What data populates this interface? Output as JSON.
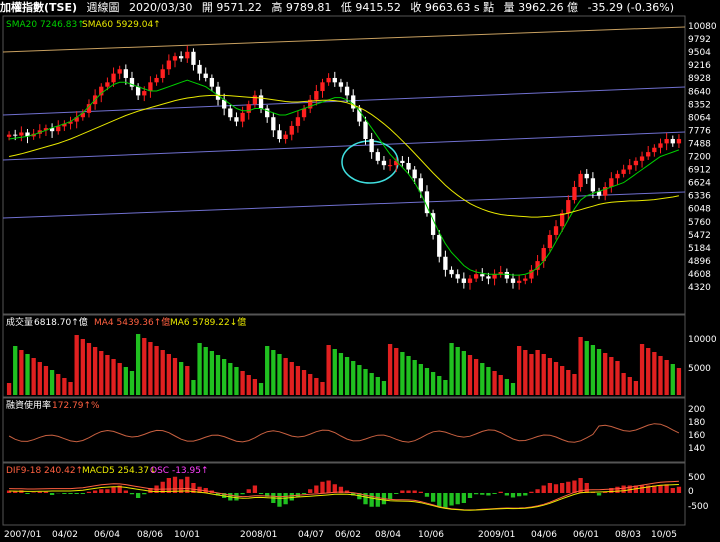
{
  "header": {
    "index_name": "加權指數(TSE)",
    "period": "週線圖",
    "date": "2020/03/30",
    "open": "開 9571.22",
    "high": "高 9789.81",
    "low": "低 9415.52",
    "close": "收 9663.63 s 點",
    "volume": "量 3962.26 億",
    "change": "-35.29 (-0.36%)"
  },
  "price_panel": {
    "sma20": "SMA20 7246.83↑",
    "sma60": "SMA60 5929.04↑",
    "sma20_color": "#00d000",
    "sma60_color": "#e8e800"
  },
  "volume_panel": {
    "label": "成交量",
    "value": "6818.70↑億",
    "ma4": "MA4 5439.36↑億",
    "ma6": "MA6 5789.22↓億"
  },
  "margin_panel": {
    "label": "融資使用率",
    "value": "172.79↑%"
  },
  "macd_panel": {
    "dif": "DIF9-18 240.42↑",
    "macd": "MACD5 254.37↓",
    "osc": "OSC -13.95↑"
  },
  "chart_data": {
    "type": "candlestick",
    "price_ticks": [
      "10080",
      "9792",
      "9504",
      "9216",
      "8928",
      "8640",
      "8352",
      "8064",
      "7776",
      "7488",
      "7200",
      "6912",
      "6624",
      "6336",
      "6048",
      "5760",
      "5472",
      "5184",
      "4896",
      "4608",
      "4320"
    ],
    "price_ylim": [
      4100,
      10200
    ],
    "volume_ticks": [
      "10000",
      "5000"
    ],
    "margin_ticks": [
      "200",
      "180",
      "160",
      "140"
    ],
    "macd_ticks": [
      "500",
      "0",
      "-500"
    ],
    "x_ticks": [
      "2007/01",
      "04/02",
      "06/04",
      "08/06",
      "10/01",
      "2008/01",
      "04/07",
      "06/02",
      "08/04",
      "10/06",
      "2009/01",
      "04/06",
      "06/01",
      "08/03",
      "10/05"
    ],
    "close_path": [
      7800,
      7780,
      7850,
      7760,
      7820,
      7900,
      7950,
      7880,
      7990,
      8050,
      8100,
      8200,
      8300,
      8500,
      8700,
      8900,
      9000,
      9200,
      9300,
      9100,
      8900,
      8700,
      8800,
      9000,
      9100,
      9300,
      9500,
      9600,
      9550,
      9700,
      9400,
      9200,
      9100,
      8900,
      8600,
      8400,
      8200,
      8100,
      8300,
      8500,
      8700,
      8400,
      8200,
      7900,
      7700,
      7800,
      8000,
      8200,
      8400,
      8600,
      8800,
      9000,
      9100,
      9000,
      8900,
      8700,
      8400,
      8100,
      7700,
      7400,
      7200,
      7100,
      7100,
      7200,
      7150,
      7000,
      6800,
      6500,
      6000,
      5500,
      5000,
      4700,
      4600,
      4500,
      4400,
      4500,
      4600,
      4550,
      4500,
      4600,
      4650,
      4500,
      4400,
      4450,
      4500,
      4700,
      4900,
      5200,
      5500,
      5700,
      6000,
      6300,
      6600,
      6900,
      6800,
      6500,
      6400,
      6600,
      6800,
      6900,
      7000,
      7100,
      7200,
      7300,
      7400,
      7500,
      7600,
      7700,
      7600,
      7700
    ],
    "sma20": [
      7700,
      7720,
      7740,
      7760,
      7800,
      7850,
      7900,
      7960,
      8000,
      8050,
      8100,
      8200,
      8300,
      8450,
      8600,
      8750,
      8850,
      8950,
      9000,
      9000,
      8950,
      8900,
      8850,
      8800,
      8800,
      8850,
      8900,
      8950,
      9000,
      9050,
      9000,
      8950,
      8900,
      8800,
      8700,
      8600,
      8500,
      8400,
      8350,
      8350,
      8400,
      8400,
      8350,
      8300,
      8250,
      8250,
      8300,
      8350,
      8400,
      8450,
      8500,
      8550,
      8600,
      8650,
      8650,
      8600,
      8500,
      8350,
      8150,
      7950,
      7750,
      7550,
      7350,
      7200,
      7050,
      6900,
      6700,
      6450,
      6150,
      5850,
      5550,
      5300,
      5100,
      4950,
      4800,
      4700,
      4650,
      4620,
      4600,
      4600,
      4600,
      4600,
      4580,
      4580,
      4600,
      4650,
      4750,
      4900,
      5100,
      5350,
      5600,
      5850,
      6100,
      6300,
      6400,
      6450,
      6500,
      6550,
      6600,
      6650,
      6700,
      6800,
      6900,
      7000,
      7100,
      7200,
      7300,
      7350,
      7400,
      7450
    ],
    "sma60": [
      7300,
      7330,
      7360,
      7400,
      7440,
      7480,
      7520,
      7560,
      7600,
      7650,
      7700,
      7760,
      7820,
      7880,
      7940,
      8000,
      8060,
      8120,
      8180,
      8240,
      8290,
      8340,
      8380,
      8420,
      8460,
      8500,
      8540,
      8580,
      8610,
      8640,
      8660,
      8680,
      8690,
      8700,
      8700,
      8700,
      8690,
      8680,
      8670,
      8660,
      8650,
      8640,
      8620,
      8600,
      8580,
      8560,
      8550,
      8550,
      8560,
      8570,
      8580,
      8590,
      8590,
      8580,
      8560,
      8530,
      8480,
      8420,
      8350,
      8260,
      8160,
      8050,
      7930,
      7800,
      7660,
      7520,
      7370,
      7220,
      7070,
      6920,
      6780,
      6640,
      6520,
      6410,
      6310,
      6220,
      6150,
      6090,
      6040,
      6000,
      5970,
      5950,
      5940,
      5930,
      5920,
      5910,
      5910,
      5920,
      5930,
      5950,
      5970,
      6000,
      6040,
      6080,
      6120,
      6160,
      6200,
      6230,
      6250,
      6260,
      6270,
      6280,
      6280,
      6290,
      6300,
      6310,
      6330,
      6350,
      6370,
      6400
    ]
  }
}
